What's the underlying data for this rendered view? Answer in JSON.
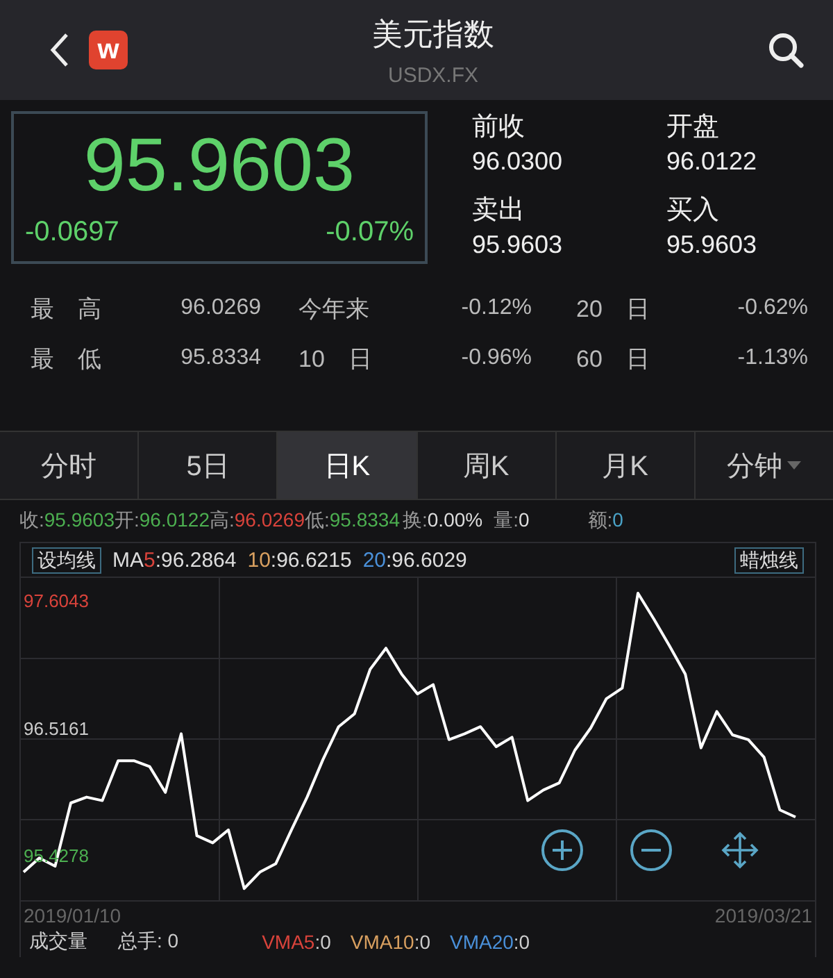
{
  "header": {
    "title": "美元指数",
    "subtitle": "USDX.FX",
    "badge": "w"
  },
  "quote": {
    "price": "95.9603",
    "change": "-0.0697",
    "change_pct": "-0.07%"
  },
  "quote_fields": [
    {
      "label": "前收",
      "value": "96.0300"
    },
    {
      "label": "开盘",
      "value": "96.0122"
    },
    {
      "label": "卖出",
      "value": "95.9603"
    },
    {
      "label": "买入",
      "value": "95.9603"
    }
  ],
  "stats": [
    [
      {
        "label": "最　高",
        "value": "96.0269"
      },
      {
        "label": "今年来",
        "value": "-0.12%"
      },
      {
        "label": "20　日",
        "value": "-0.62%"
      }
    ],
    [
      {
        "label": "最　低",
        "value": "95.8334"
      },
      {
        "label": "10　日",
        "value": "-0.96%"
      },
      {
        "label": "60　日",
        "value": "-1.13%"
      }
    ]
  ],
  "tabs": [
    {
      "label": "分时",
      "selected": false
    },
    {
      "label": "5日",
      "selected": false
    },
    {
      "label": "日K",
      "selected": true
    },
    {
      "label": "周K",
      "selected": false
    },
    {
      "label": "月K",
      "selected": false
    },
    {
      "label": "分钟",
      "selected": false,
      "dropdown": true
    }
  ],
  "ohlc": [
    {
      "label": "收:",
      "value": "95.9603",
      "color": "#4caf50"
    },
    {
      "label": "开:",
      "value": "96.0122",
      "color": "#4caf50"
    },
    {
      "label": "高:",
      "value": "96.0269",
      "color": "#d9433b"
    },
    {
      "label": "低:",
      "value": "95.8334",
      "color": "#4caf50"
    },
    {
      "label": "换:",
      "value": "0.00%",
      "color": "#dddddd"
    },
    {
      "label": "量:",
      "value": "0",
      "color": "#dddddd"
    },
    {
      "label": "额:",
      "value": "0",
      "color": "#4aa3c8"
    }
  ],
  "ma_button": "设均线",
  "candle_button": "蜡烛线",
  "ma": [
    {
      "label": "MA",
      "num": "5",
      "value": ":96.2864",
      "color": "#d9433b"
    },
    {
      "num": "10",
      "value": ":96.6215",
      "color": "#d9a060"
    },
    {
      "num": "20",
      "value": ":96.6029",
      "color": "#4a90d9"
    }
  ],
  "chart": {
    "start_date": "2019/01/10",
    "end_date": "2019/03/21",
    "chart_data": {
      "type": "line",
      "ylim": [
        95.05,
        97.8
      ],
      "yticks": [
        {
          "value": 97.6043,
          "label": "97.6043"
        },
        {
          "value": 96.5161,
          "label": "96.5161"
        },
        {
          "value": 95.4278,
          "label": "95.4278"
        }
      ],
      "series": [
        {
          "color": "#ffffff",
          "values": [
            95.29,
            95.41,
            95.34,
            95.88,
            95.93,
            95.9,
            96.24,
            96.24,
            96.19,
            95.97,
            96.47,
            95.6,
            95.54,
            95.65,
            95.15,
            95.29,
            95.36,
            95.65,
            95.93,
            96.25,
            96.53,
            96.64,
            97.02,
            97.2,
            96.98,
            96.81,
            96.89,
            96.42,
            96.47,
            96.53,
            96.36,
            96.44,
            95.9,
            95.99,
            96.05,
            96.33,
            96.52,
            96.77,
            96.86,
            97.67,
            97.45,
            97.22,
            96.98,
            96.35,
            96.66,
            96.46,
            96.42,
            96.27,
            95.82,
            95.76
          ]
        }
      ]
    }
  },
  "volume": {
    "label": "成交量",
    "total_label": "总手:",
    "total": "0",
    "vma": [
      {
        "label": "VMA5",
        "value": ":0",
        "color": "#d9433b"
      },
      {
        "label": "VMA10",
        "value": ":0",
        "color": "#d9a060"
      },
      {
        "label": "VMA20",
        "value": ":0",
        "color": "#4a90d9"
      }
    ]
  }
}
